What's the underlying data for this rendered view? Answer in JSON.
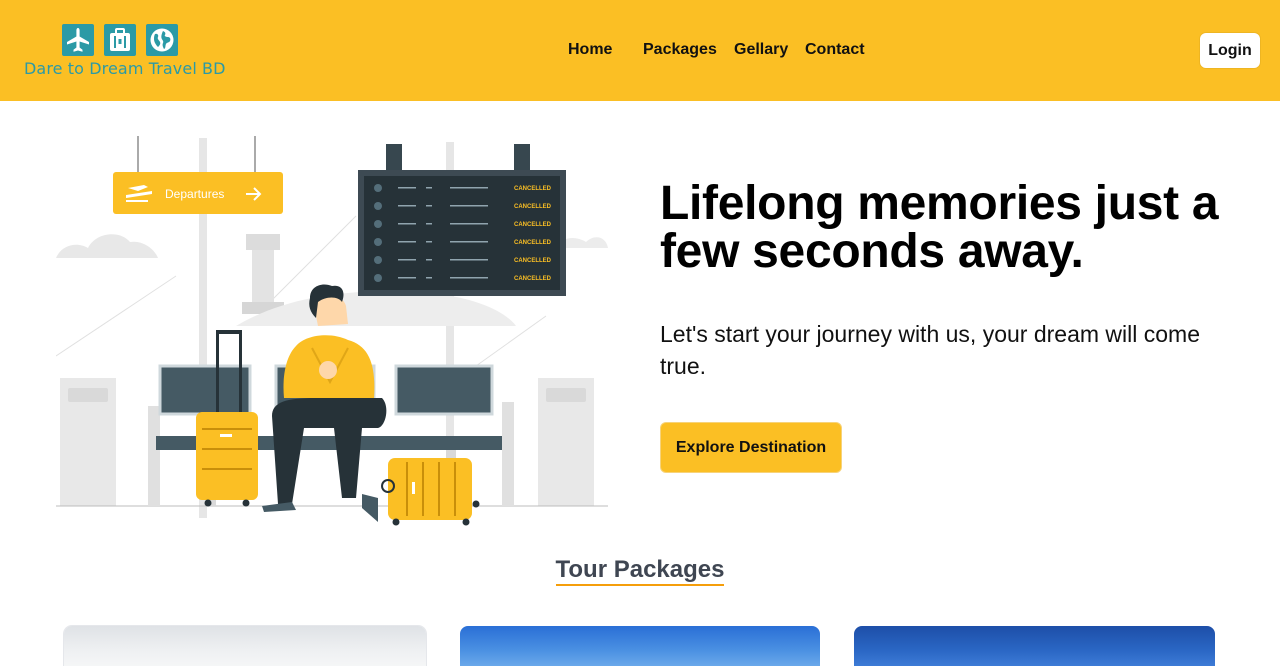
{
  "brand": {
    "name": "Dare to Dream Travel BD",
    "icons": [
      "airplane-icon",
      "suitcase-icon",
      "globe-icon"
    ],
    "color": "#2b9aa6"
  },
  "nav": {
    "items": [
      "Home",
      "Packages",
      "Gellary",
      "Contact"
    ],
    "login_label": "Login",
    "background": "#fbbf24"
  },
  "hero": {
    "title": "Lifelong memories just a few seconds away.",
    "subtitle": "Let's start your journey with us, your dream will come true.",
    "cta_label": "Explore Destination",
    "illustration": {
      "sign_text": "Departures",
      "board_status": [
        "CANCELLED",
        "CANCELLED",
        "CANCELLED",
        "CANCELLED",
        "CANCELLED",
        "CANCELLED"
      ]
    }
  },
  "packages": {
    "title": "Tour Packages",
    "accent": "#f59e0b"
  }
}
